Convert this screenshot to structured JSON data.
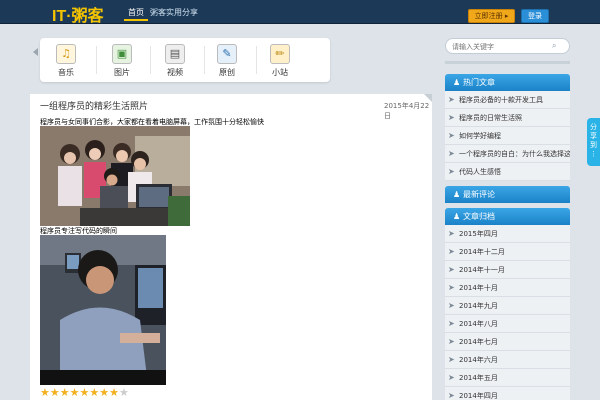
{
  "header": {
    "logo": "IT·粥客",
    "nav_home": "首页",
    "nav_link": "粥客实用分享",
    "register_label": "立即注册 ▸",
    "login_label": "登录"
  },
  "categories": [
    {
      "label": "音乐",
      "icon": "music-icon",
      "glyph": "♫"
    },
    {
      "label": "图片",
      "icon": "picture-icon",
      "glyph": "▣"
    },
    {
      "label": "视频",
      "icon": "video-icon",
      "glyph": "▤"
    },
    {
      "label": "原创",
      "icon": "original-icon",
      "glyph": "✎"
    },
    {
      "label": "小站",
      "icon": "site-icon",
      "glyph": "✏"
    }
  ],
  "article": {
    "title": "一组程序员的精彩生活照片",
    "date": "2015年4月22日",
    "caption1": "程序员与女同事们合影，大家都在看着电脑屏幕，工作氛围十分轻松愉快",
    "caption2": "程序员专注写代码的瞬间",
    "rating": 8,
    "rating_max": 9
  },
  "sidebar": {
    "search_placeholder": "请输入关键字",
    "boxes": [
      {
        "title": "热门文章",
        "items": [
          "程序员必备的十款开发工具",
          "程序员的日常生活照",
          "如何学好编程",
          "一个程序员的自白：为什么我选择这份工作",
          "代码人生感悟"
        ]
      },
      {
        "title": "最新评论",
        "items": []
      },
      {
        "title": "文章归档",
        "items": [
          "2015年四月",
          "2014年十二月",
          "2014年十一月",
          "2014年十月",
          "2014年九月",
          "2014年八月",
          "2014年七月",
          "2014年六月",
          "2014年五月",
          "2014年四月"
        ]
      }
    ]
  },
  "share": {
    "label": "分享到"
  },
  "colors": {
    "accent": "#1b82c8",
    "topbar": "#1c3a58",
    "logo": "#f5c400"
  }
}
